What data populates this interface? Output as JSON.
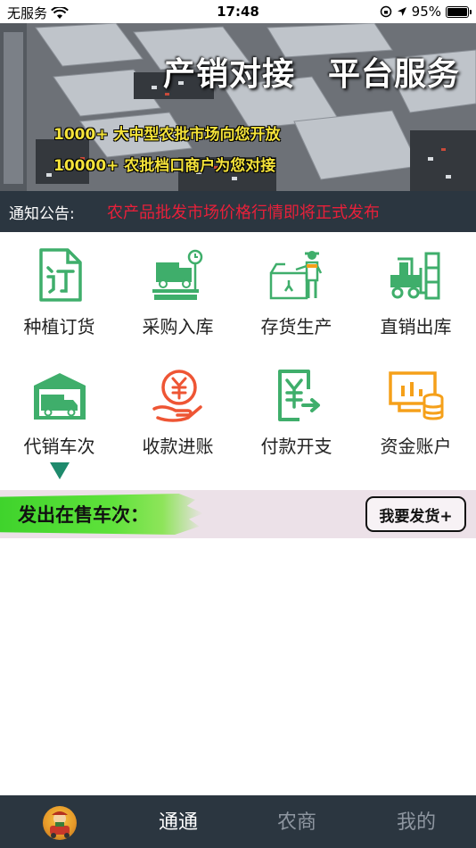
{
  "status_bar": {
    "carrier": "无服务",
    "time": "17:48",
    "battery": "95%"
  },
  "banner": {
    "headline": "产销对接　平台服务",
    "line1": "1000+ 大中型农批市场向您开放",
    "line2": "10000+ 农批档口商户为您对接"
  },
  "notice": {
    "label": "通知公告:",
    "text": "农产品批发市场价格行情即将正式发布"
  },
  "grid": {
    "items": [
      {
        "label": "种植订货",
        "icon": "order-document-icon"
      },
      {
        "label": "采购入库",
        "icon": "purchase-scale-icon"
      },
      {
        "label": "存货生产",
        "icon": "inventory-worker-icon"
      },
      {
        "label": "直销出库",
        "icon": "forklift-icon"
      },
      {
        "label": "代销车次",
        "icon": "consignment-truck-icon"
      },
      {
        "label": "收款进账",
        "icon": "receive-payment-icon"
      },
      {
        "label": "付款开支",
        "icon": "payment-expense-icon"
      },
      {
        "label": "资金账户",
        "icon": "fund-account-icon"
      }
    ]
  },
  "section": {
    "title": "发出在售车次：",
    "button": "我要发货+"
  },
  "tab_bar": {
    "tabs": [
      {
        "label": "通通",
        "active": true
      },
      {
        "label": "农商",
        "active": false
      },
      {
        "label": "我的",
        "active": false
      }
    ]
  },
  "colors": {
    "icon_green": "#3fae6b",
    "icon_orange": "#f5a01a",
    "icon_red": "#ee5534",
    "notice_red": "#e8203a",
    "dark_bar": "#2b3640"
  }
}
